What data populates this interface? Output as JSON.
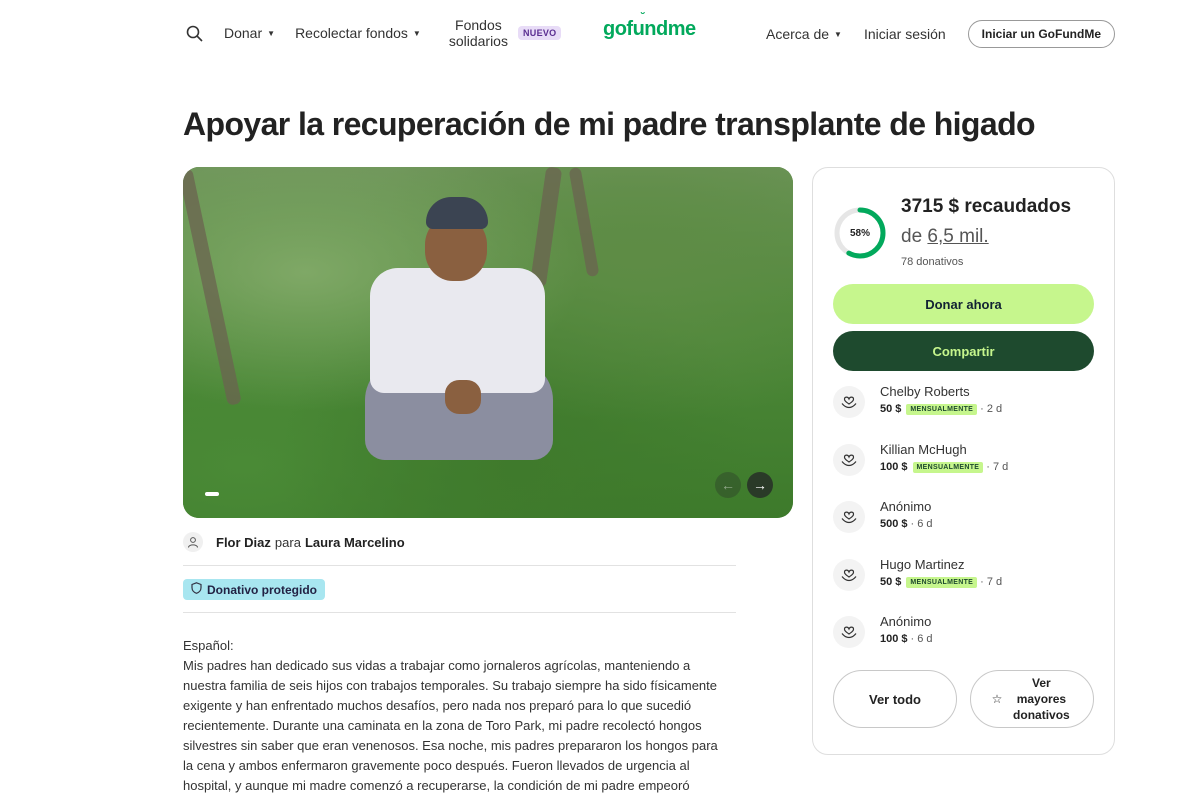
{
  "header": {
    "donate_label": "Donar",
    "collect_label": "Recolectar fondos",
    "fondos_line1": "Fondos",
    "fondos_line2": "solidarios",
    "nuevo_badge": "NUEVO",
    "logo_text": "gofundme",
    "about_label": "Acerca de",
    "login_label": "Iniciar sesión",
    "start_label": "Iniciar un GoFundMe"
  },
  "campaign": {
    "title": "Apoyar la recuperación de mi padre transplante de higado",
    "organizer_name": "Flor Diaz",
    "organizer_connector": "para",
    "beneficiary_name": "Laura Marcelino",
    "protected_label": "Donativo protegido",
    "story_lang": "Español:",
    "story_text": "Mis padres han dedicado sus vidas a trabajar como jornaleros agrícolas, manteniendo a nuestra familia de seis hijos con trabajos temporales. Su trabajo siempre ha sido físicamente exigente y han enfrentado muchos desafíos, pero nada nos preparó para lo que sucedió recientemente. Durante una caminata en la zona de Toro Park, mi padre recolectó hongos silvestres sin saber que eran venenosos. Esa noche, mis padres prepararon los hongos para la cena y ambos enfermaron gravemente poco después. Fueron llevados de urgencia al hospital, y aunque mi madre comenzó a recuperarse, la condición de mi padre empeoró rápidamente. Fue trasladado al hospital de Stanford"
  },
  "funding": {
    "percent_label": "58%",
    "percent_value": 58,
    "raised_text": "3715 $ recaudados",
    "goal_prefix": "de",
    "goal_amount": "6,5 mil.",
    "donations_count": "78 donativos",
    "donate_now_label": "Donar ahora",
    "share_label": "Compartir"
  },
  "donors": [
    {
      "name": "Chelby Roberts",
      "amount": "50 $",
      "monthly": "MENSUALMENTE",
      "time": "· 2 d"
    },
    {
      "name": "Killian McHugh",
      "amount": "100 $",
      "monthly": "MENSUALMENTE",
      "time": "· 7 d"
    },
    {
      "name": "Anónimo",
      "amount": "500 $",
      "monthly": "",
      "time": "· 6 d"
    },
    {
      "name": "Hugo Martinez",
      "amount": "50 $",
      "monthly": "MENSUALMENTE",
      "time": "· 7 d"
    },
    {
      "name": "Anónimo",
      "amount": "100 $",
      "monthly": "",
      "time": "· 6 d"
    }
  ],
  "actions": {
    "see_all_label": "Ver todo",
    "see_top_label": "Ver mayores donativos"
  },
  "colors": {
    "brand_green": "#02a95c",
    "lime": "#c6f68d",
    "dark_green": "#1e4a2e",
    "protected_blue": "#a8e6f0"
  }
}
